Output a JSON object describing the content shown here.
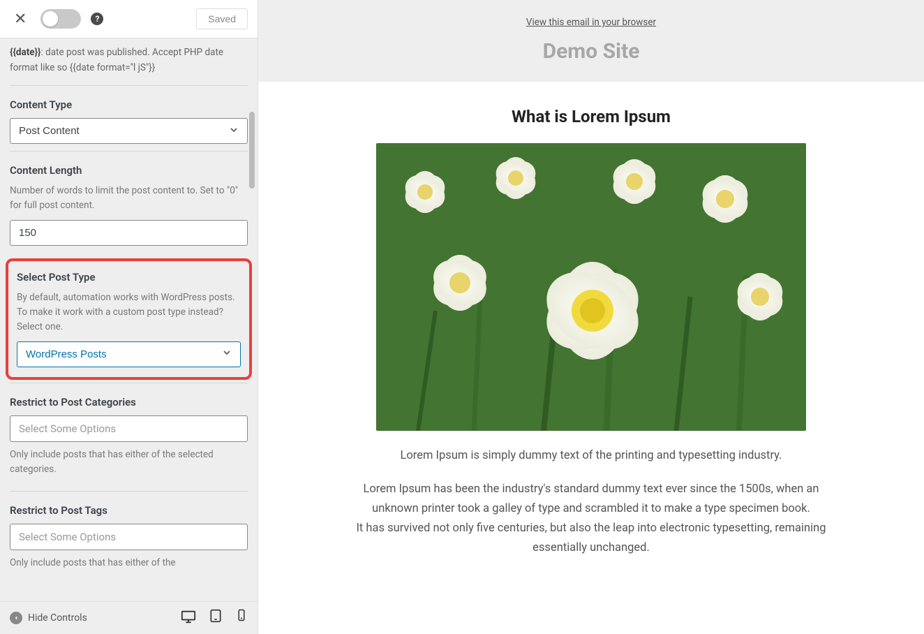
{
  "header": {
    "saved_label": "Saved"
  },
  "hint": {
    "tag": "{{date}}",
    "text": ": date post was published. Accept PHP date format like so {{date format=\"l jS\"}}"
  },
  "content_type": {
    "label": "Content Type",
    "value": "Post Content"
  },
  "content_length": {
    "label": "Content Length",
    "desc": "Number of words to limit the post content to. Set to \"0\" for full post content.",
    "value": "150"
  },
  "post_type": {
    "label": "Select Post Type",
    "desc": "By default, automation works with WordPress posts. To make it work with a custom post type instead? Select one.",
    "value": "WordPress Posts"
  },
  "categories": {
    "label": "Restrict to Post Categories",
    "placeholder": "Select Some Options",
    "desc": "Only include posts that has either of the selected categories."
  },
  "tags": {
    "label": "Restrict to Post Tags",
    "placeholder": "Select Some Options",
    "desc": "Only include posts that has either of the"
  },
  "footer": {
    "hide_label": "Hide Controls"
  },
  "preview": {
    "view_link": "View this email in your browser",
    "site_name": "Demo Site",
    "post_title": "What is Lorem Ipsum",
    "p1": "Lorem Ipsum is simply dummy text of the printing and typesetting industry.",
    "p2": "Lorem Ipsum has been the industry's standard dummy text ever since the 1500s, when an unknown printer took a galley of type and scrambled it to make a type specimen book.",
    "p3": "It has survived not only five centuries, but also the leap into electronic typesetting, remaining essentially unchanged."
  }
}
